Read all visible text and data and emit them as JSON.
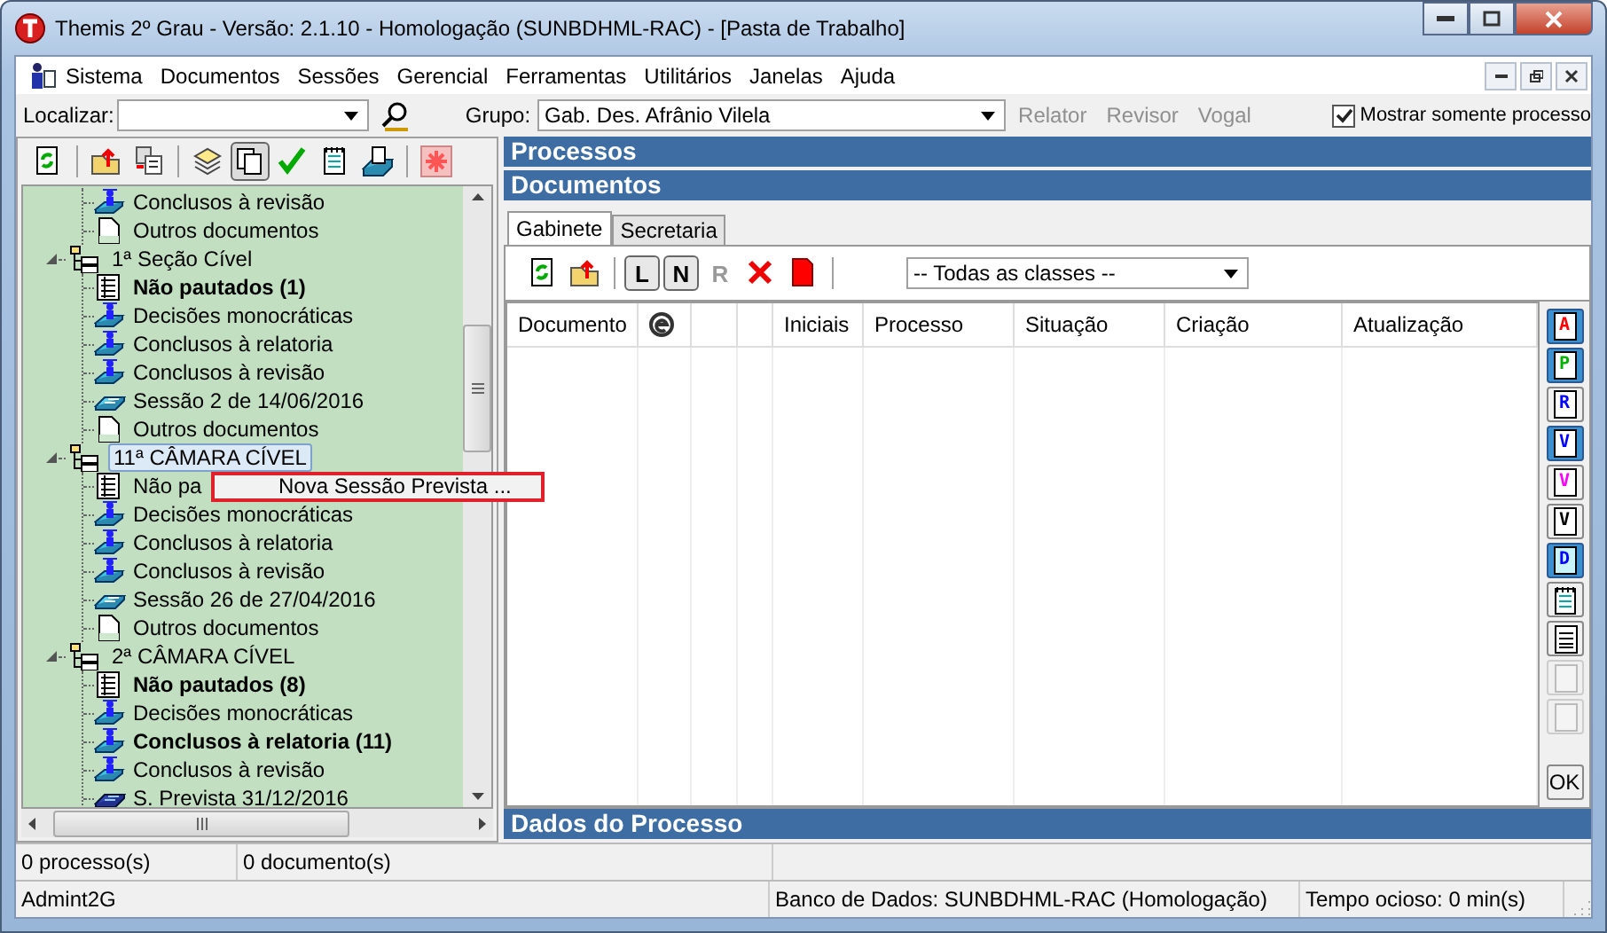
{
  "window": {
    "title": "Themis 2º Grau - Versão: 2.1.10 - Homologação (SUNBDHML-RAC) - [Pasta de Trabalho]"
  },
  "menu": [
    "Sistema",
    "Documentos",
    "Sessões",
    "Gerencial",
    "Ferramentas",
    "Utilitários",
    "Janelas",
    "Ajuda"
  ],
  "search_bar": {
    "label": "Localizar:",
    "group_label": "Grupo:",
    "group_value": "Gab. Des. Afrânio Vilela",
    "role_buttons": [
      {
        "label": "Relator",
        "disabled": true
      },
      {
        "label": "Revisor",
        "disabled": true
      },
      {
        "label": "Vogal",
        "disabled": true
      }
    ],
    "only_mine": {
      "label": "Mostrar somente processo",
      "checked": true
    }
  },
  "left_toolbar": [
    {
      "kind": "refresh",
      "pressed": false
    },
    {
      "kind": "export",
      "pressed": false
    },
    {
      "kind": "transfer",
      "pressed": false
    },
    {
      "kind": "stack",
      "pressed": false
    },
    {
      "kind": "copy",
      "pressed": true
    },
    {
      "kind": "check",
      "pressed": false
    },
    {
      "kind": "notepad",
      "pressed": false
    },
    {
      "kind": "tray",
      "pressed": false
    },
    {
      "kind": "asterisk",
      "pressed": false
    }
  ],
  "tree": [
    {
      "children": [
        {
          "label": "Conclusos à revisão",
          "kind": "judge",
          "bold": false,
          "selected": false
        },
        {
          "label": "Outros documentos",
          "kind": "page",
          "bold": false,
          "selected": false
        }
      ]
    },
    {
      "label": "1ª Seção Cível",
      "kind": "group",
      "expanded": true,
      "selected": false,
      "children": [
        {
          "label": "Não pautados (1)",
          "kind": "list",
          "bold": true,
          "selected": false
        },
        {
          "label": "Decisões monocráticas",
          "kind": "judge",
          "bold": false,
          "selected": false
        },
        {
          "label": "Conclusos à relatoria",
          "kind": "judge",
          "bold": false,
          "selected": false
        },
        {
          "label": "Conclusos à revisão",
          "kind": "judge",
          "bold": false,
          "selected": false
        },
        {
          "label": "Sessão 2 de 14/06/2016",
          "kind": "session",
          "bold": false,
          "selected": false
        },
        {
          "label": "Outros documentos",
          "kind": "page",
          "bold": false,
          "selected": false
        }
      ]
    },
    {
      "label": "11ª CÂMARA CÍVEL",
      "kind": "group",
      "expanded": true,
      "selected": true,
      "children": [
        {
          "label": "Não pa",
          "kind": "list",
          "bold": false,
          "selected": false
        },
        {
          "label": "Decisões monocráticas",
          "kind": "judge",
          "bold": false,
          "selected": false
        },
        {
          "label": "Conclusos à relatoria",
          "kind": "judge",
          "bold": false,
          "selected": false
        },
        {
          "label": "Conclusos à revisão",
          "kind": "judge",
          "bold": false,
          "selected": false
        },
        {
          "label": "Sessão 26 de 27/04/2016",
          "kind": "session",
          "bold": false,
          "selected": false
        },
        {
          "label": "Outros documentos",
          "kind": "page",
          "bold": false,
          "selected": false
        }
      ]
    },
    {
      "label": "2ª CÂMARA CÍVEL",
      "kind": "group",
      "expanded": true,
      "selected": false,
      "children": [
        {
          "label": "Não pautados (8)",
          "kind": "list",
          "bold": true,
          "selected": false
        },
        {
          "label": "Decisões monocráticas",
          "kind": "judge",
          "bold": false,
          "selected": false
        },
        {
          "label": "Conclusos à relatoria (11)",
          "kind": "judge",
          "bold": true,
          "selected": false
        },
        {
          "label": "Conclusos à revisão",
          "kind": "judge",
          "bold": false,
          "selected": false
        },
        {
          "label": "S. Prevista 31/12/2016",
          "kind": "planned",
          "bold": false,
          "selected": false
        }
      ]
    }
  ],
  "context_menu": {
    "items": [
      "Nova Sessão Prevista ..."
    ]
  },
  "processos_header": "Processos",
  "documentos_header": "Documentos",
  "doc_tabs": [
    {
      "label": "Gabinete",
      "selected": true
    },
    {
      "label": "Secretaria",
      "selected": false
    }
  ],
  "doc_toolbar": [
    {
      "kind": "refresh"
    },
    {
      "kind": "export"
    },
    {
      "kind": "letter",
      "label": "L",
      "pressed": true,
      "disabled": false
    },
    {
      "kind": "letter",
      "label": "N",
      "pressed": true,
      "disabled": false
    },
    {
      "kind": "letter",
      "label": "R",
      "pressed": false,
      "disabled": true
    },
    {
      "kind": "delete"
    },
    {
      "kind": "red-page"
    }
  ],
  "class_filter": {
    "value": "-- Todas as classes --"
  },
  "table": {
    "columns": [
      {
        "kind": "text",
        "label": "Documento"
      },
      {
        "kind": "icon"
      },
      {
        "kind": "empty"
      },
      {
        "kind": "empty"
      },
      {
        "kind": "text",
        "label": "Iniciais"
      },
      {
        "kind": "text",
        "label": "Processo"
      },
      {
        "kind": "text",
        "label": "Situação"
      },
      {
        "kind": "text",
        "label": "Criação"
      },
      {
        "kind": "text",
        "label": "Atualização"
      }
    ]
  },
  "side_buttons": [
    {
      "kind": "letter",
      "label": "A",
      "color": "#ff0000",
      "pressed": true
    },
    {
      "kind": "letter",
      "label": "P",
      "color": "#00b000",
      "pressed": true
    },
    {
      "kind": "letter",
      "label": "R",
      "color": "#0000ff",
      "pressed": false
    },
    {
      "kind": "letter",
      "label": "V",
      "color": "#0000ff",
      "pressed": true
    },
    {
      "kind": "letter",
      "label": "V",
      "color": "#ff00ff",
      "pressed": false
    },
    {
      "kind": "letter",
      "label": "V",
      "color": "#000000",
      "pressed": false
    },
    {
      "kind": "letter",
      "label": "D",
      "color": "#0000ff",
      "pressed": true
    },
    {
      "kind": "notepad",
      "pressed": false
    },
    {
      "kind": "document",
      "pressed": false
    },
    {
      "kind": "blank",
      "pressed": false
    },
    {
      "kind": "blank",
      "pressed": false
    },
    {
      "kind": "ok",
      "label": "OK",
      "pressed": false
    }
  ],
  "details_header": "Dados do Processo",
  "status_bar": {
    "row_1": [
      "0 processo(s)",
      "0 documento(s)"
    ],
    "row_2": [
      "Admint2G",
      "Banco de Dados: SUNBDHML-RAC (Homologação)",
      "Tempo ocioso: 0 min(s)"
    ]
  }
}
